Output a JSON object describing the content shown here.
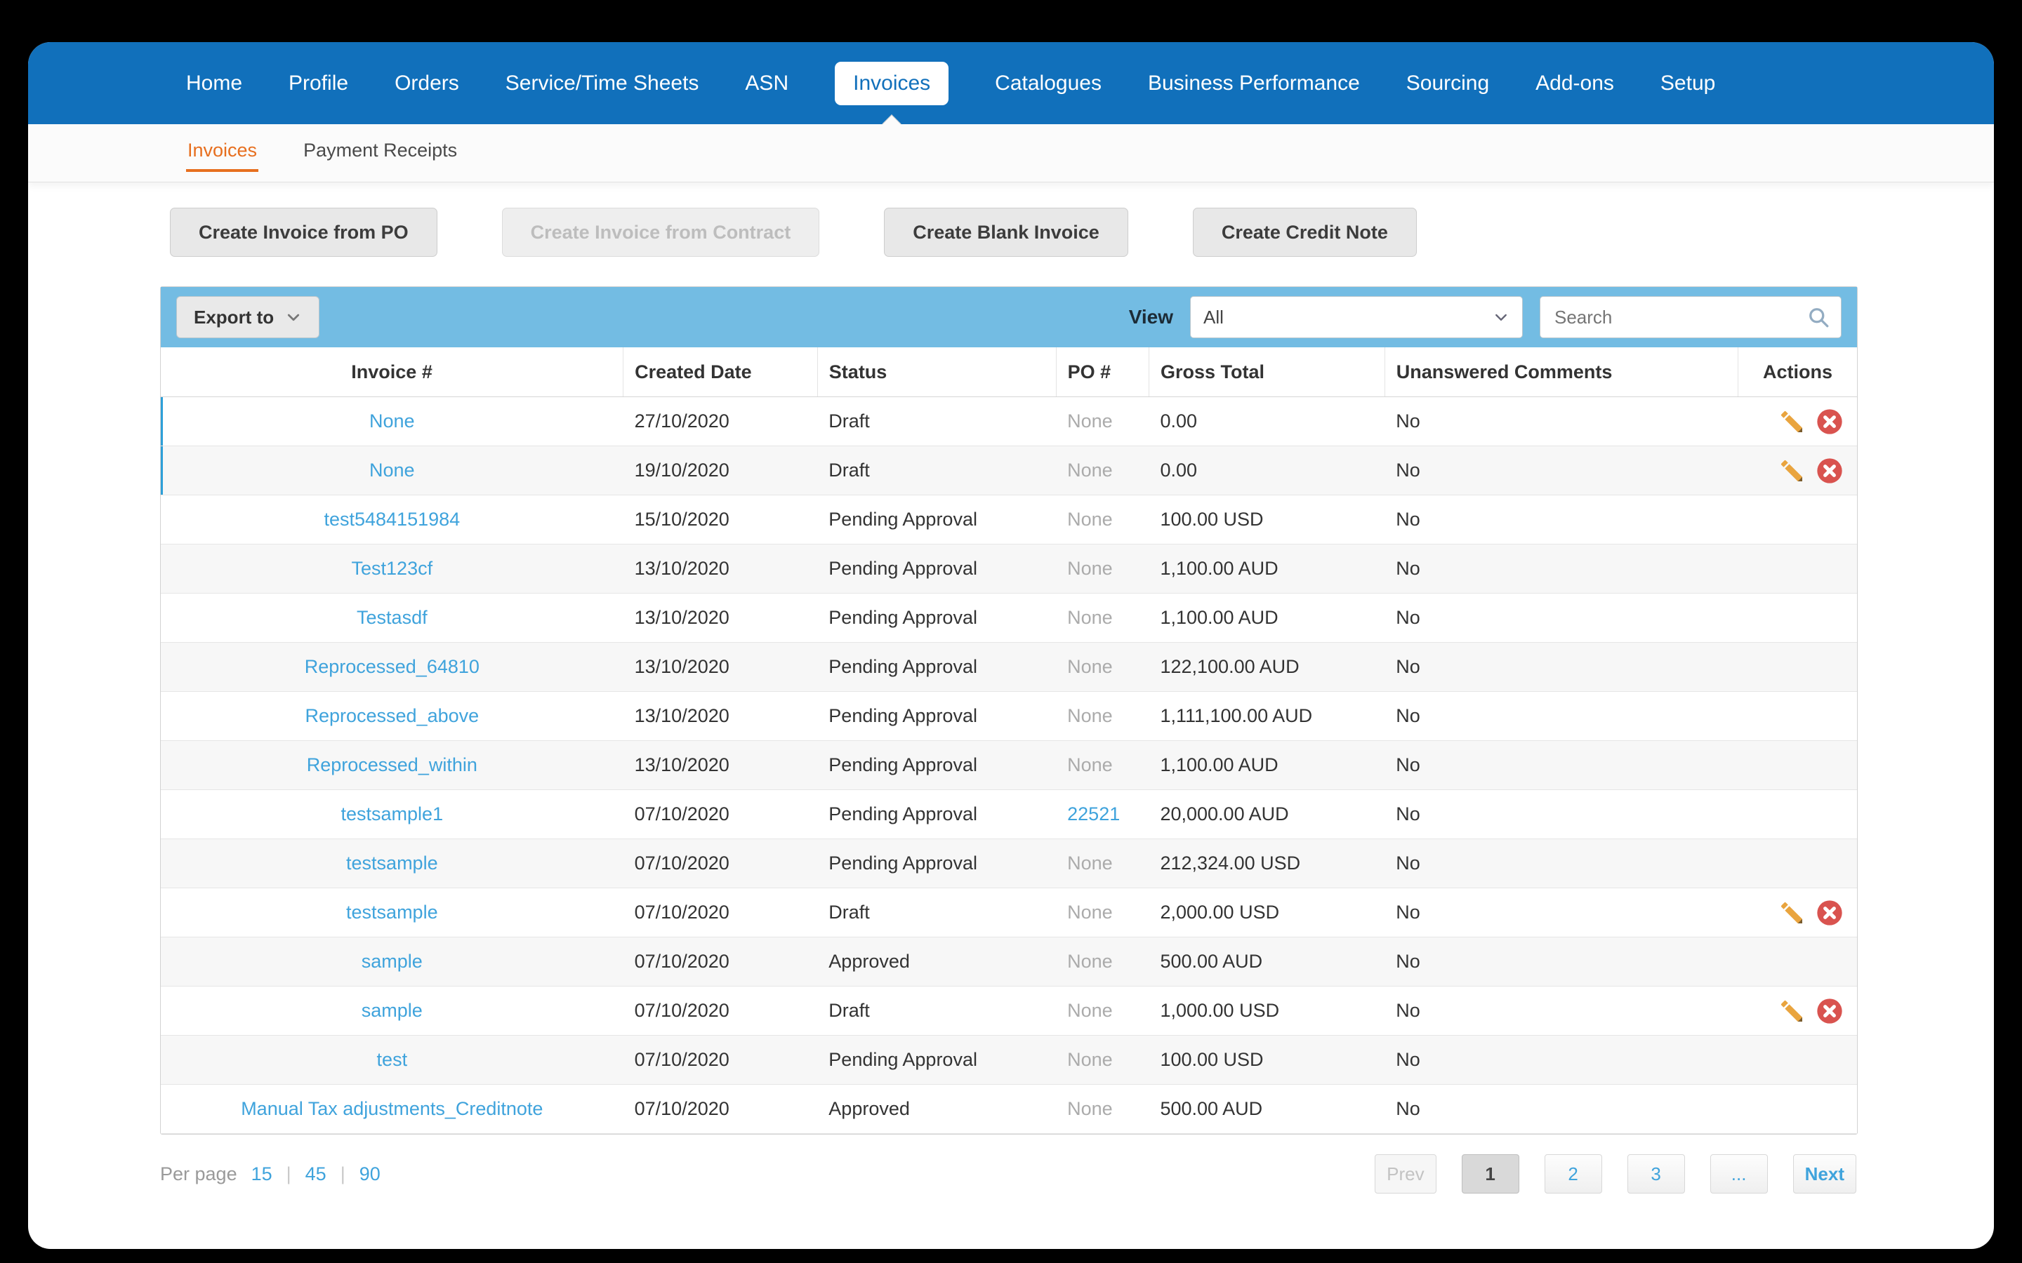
{
  "nav": {
    "items": [
      "Home",
      "Profile",
      "Orders",
      "Service/Time Sheets",
      "ASN",
      "Invoices",
      "Catalogues",
      "Business Performance",
      "Sourcing",
      "Add-ons",
      "Setup"
    ],
    "active": "Invoices"
  },
  "subnav": {
    "tabs": [
      {
        "label": "Invoices",
        "active": true
      },
      {
        "label": "Payment Receipts",
        "active": false
      }
    ]
  },
  "actions": {
    "buttons": [
      {
        "label": "Create Invoice from PO",
        "disabled": false
      },
      {
        "label": "Create Invoice from Contract",
        "disabled": true
      },
      {
        "label": "Create Blank Invoice",
        "disabled": false
      },
      {
        "label": "Create Credit Note",
        "disabled": false
      }
    ]
  },
  "toolbar": {
    "export_label": "Export to",
    "view_label": "View",
    "view_selected": "All",
    "search_placeholder": "Search"
  },
  "table": {
    "columns": [
      "Invoice #",
      "Created Date",
      "Status",
      "PO #",
      "Gross Total",
      "Unanswered Comments",
      "Actions"
    ],
    "rows": [
      {
        "invoice": "None",
        "date": "27/10/2020",
        "status": "Draft",
        "po": "None",
        "po_is_link": false,
        "gross": "0.00",
        "comments": "No",
        "has_actions": true,
        "selected": true
      },
      {
        "invoice": "None",
        "date": "19/10/2020",
        "status": "Draft",
        "po": "None",
        "po_is_link": false,
        "gross": "0.00",
        "comments": "No",
        "has_actions": true,
        "selected": true
      },
      {
        "invoice": "test5484151984",
        "date": "15/10/2020",
        "status": "Pending Approval",
        "po": "None",
        "po_is_link": false,
        "gross": "100.00 USD",
        "comments": "No",
        "has_actions": false,
        "selected": false
      },
      {
        "invoice": "Test123cf",
        "date": "13/10/2020",
        "status": "Pending Approval",
        "po": "None",
        "po_is_link": false,
        "gross": "1,100.00 AUD",
        "comments": "No",
        "has_actions": false,
        "selected": false
      },
      {
        "invoice": "Testasdf",
        "date": "13/10/2020",
        "status": "Pending Approval",
        "po": "None",
        "po_is_link": false,
        "gross": "1,100.00 AUD",
        "comments": "No",
        "has_actions": false,
        "selected": false
      },
      {
        "invoice": "Reprocessed_64810",
        "date": "13/10/2020",
        "status": "Pending Approval",
        "po": "None",
        "po_is_link": false,
        "gross": "122,100.00 AUD",
        "comments": "No",
        "has_actions": false,
        "selected": false
      },
      {
        "invoice": "Reprocessed_above",
        "date": "13/10/2020",
        "status": "Pending Approval",
        "po": "None",
        "po_is_link": false,
        "gross": "1,111,100.00 AUD",
        "comments": "No",
        "has_actions": false,
        "selected": false
      },
      {
        "invoice": "Reprocessed_within",
        "date": "13/10/2020",
        "status": "Pending Approval",
        "po": "None",
        "po_is_link": false,
        "gross": "1,100.00 AUD",
        "comments": "No",
        "has_actions": false,
        "selected": false
      },
      {
        "invoice": "testsample1",
        "date": "07/10/2020",
        "status": "Pending Approval",
        "po": "22521",
        "po_is_link": true,
        "gross": "20,000.00 AUD",
        "comments": "No",
        "has_actions": false,
        "selected": false
      },
      {
        "invoice": "testsample",
        "date": "07/10/2020",
        "status": "Pending Approval",
        "po": "None",
        "po_is_link": false,
        "gross": "212,324.00 USD",
        "comments": "No",
        "has_actions": false,
        "selected": false
      },
      {
        "invoice": "testsample",
        "date": "07/10/2020",
        "status": "Draft",
        "po": "None",
        "po_is_link": false,
        "gross": "2,000.00 USD",
        "comments": "No",
        "has_actions": true,
        "selected": false
      },
      {
        "invoice": "sample",
        "date": "07/10/2020",
        "status": "Approved",
        "po": "None",
        "po_is_link": false,
        "gross": "500.00 AUD",
        "comments": "No",
        "has_actions": false,
        "selected": false
      },
      {
        "invoice": "sample",
        "date": "07/10/2020",
        "status": "Draft",
        "po": "None",
        "po_is_link": false,
        "gross": "1,000.00 USD",
        "comments": "No",
        "has_actions": true,
        "selected": false
      },
      {
        "invoice": "test",
        "date": "07/10/2020",
        "status": "Pending Approval",
        "po": "None",
        "po_is_link": false,
        "gross": "100.00 USD",
        "comments": "No",
        "has_actions": false,
        "selected": false
      },
      {
        "invoice": "Manual Tax adjustments_Creditnote",
        "date": "07/10/2020",
        "status": "Approved",
        "po": "None",
        "po_is_link": false,
        "gross": "500.00 AUD",
        "comments": "No",
        "has_actions": false,
        "selected": false
      }
    ]
  },
  "footer": {
    "per_page_label": "Per page",
    "per_page_options": [
      "15",
      "45",
      "90"
    ],
    "separator": "|",
    "pagination": {
      "prev": "Prev",
      "pages": [
        "1",
        "2",
        "3"
      ],
      "current": "1",
      "ellipsis": "...",
      "next": "Next"
    }
  },
  "icons": {
    "edit": "edit-pencil-icon",
    "delete": "delete-x-icon",
    "search": "search-icon",
    "chevron": "chevron-down-icon"
  },
  "colors": {
    "nav_blue": "#1170BB",
    "accent_orange": "#E76F1F",
    "link_blue": "#3FA3DC",
    "panel_blue": "#73BCE3",
    "action_red": "#D9534F",
    "selected_bar_blue": "#2D9FD8"
  }
}
